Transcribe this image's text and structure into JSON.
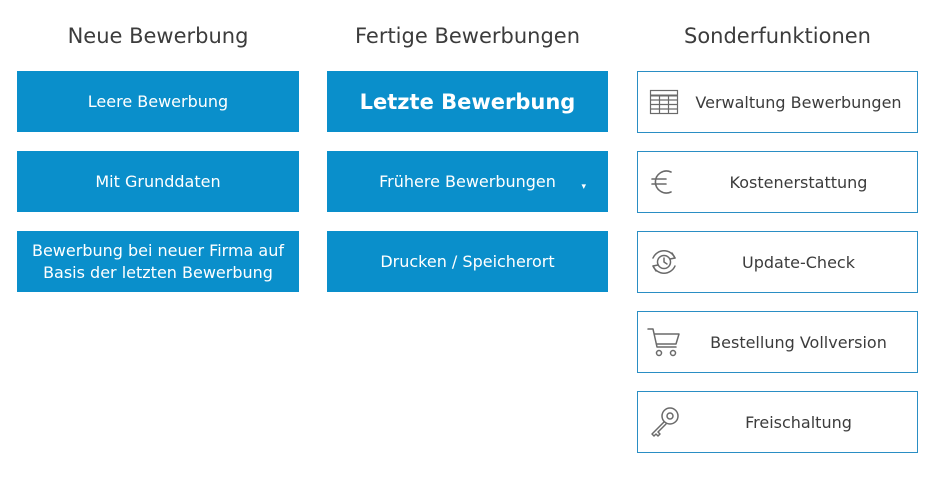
{
  "columns": {
    "new": {
      "title": "Neue Bewerbung",
      "buttons": [
        "Leere Bewerbung",
        "Mit Grunddaten",
        "Bewerbung bei neuer Firma auf Basis der letzten Bewerbung"
      ]
    },
    "finished": {
      "title": "Fertige Bewerbungen",
      "buttons": [
        "Letzte Bewerbung",
        "Frühere Bewerbungen",
        "Drucken / Speicherort"
      ],
      "dropdown_glyph": "▾"
    },
    "special": {
      "title": "Sonderfunktionen",
      "buttons": [
        {
          "label": "Verwaltung Bewerbungen",
          "icon": "table-icon"
        },
        {
          "label": "Kostenerstattung",
          "icon": "euro-icon"
        },
        {
          "label": "Update-Check",
          "icon": "update-clock-icon"
        },
        {
          "label": "Bestellung Vollversion",
          "icon": "cart-icon"
        },
        {
          "label": "Freischaltung",
          "icon": "key-icon"
        }
      ]
    }
  },
  "colors": {
    "primary": "#0a8fcb",
    "border": "#2a8ec4",
    "text": "#3c3c3c",
    "icon": "#6a6a6a"
  }
}
